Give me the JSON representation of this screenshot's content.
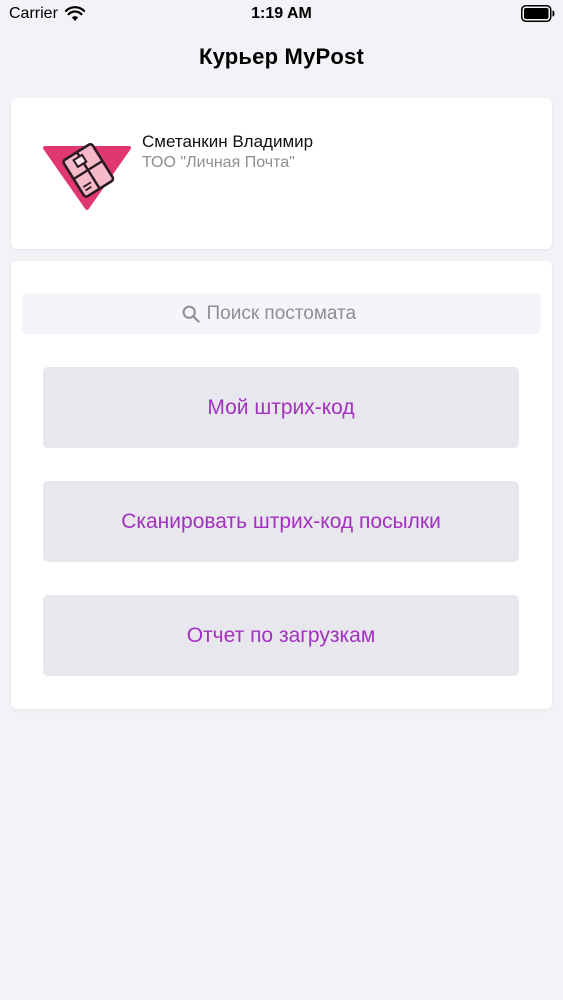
{
  "status_bar": {
    "carrier": "Carrier",
    "time": "1:19 AM",
    "battery_icon": "battery-full-icon",
    "wifi_icon": "wifi-icon"
  },
  "nav": {
    "title": "Курьер MyPost"
  },
  "profile": {
    "name": "Сметанкин Владимир",
    "company": "ТОО \"Личная Почта\"",
    "logo_icon": "mypost-logo-icon"
  },
  "search": {
    "placeholder": "Поиск постомата",
    "value": "",
    "icon": "search-icon"
  },
  "buttons": {
    "my_barcode": "Мой штрих-код",
    "scan_barcode": "Сканировать штрих-код посылки",
    "upload_report": "Отчет по загрузкам"
  },
  "colors": {
    "accent": "#a330c0",
    "logo_pink": "#e0386e",
    "background": "#f2f2f7",
    "button_bg": "#e7e7ed"
  }
}
